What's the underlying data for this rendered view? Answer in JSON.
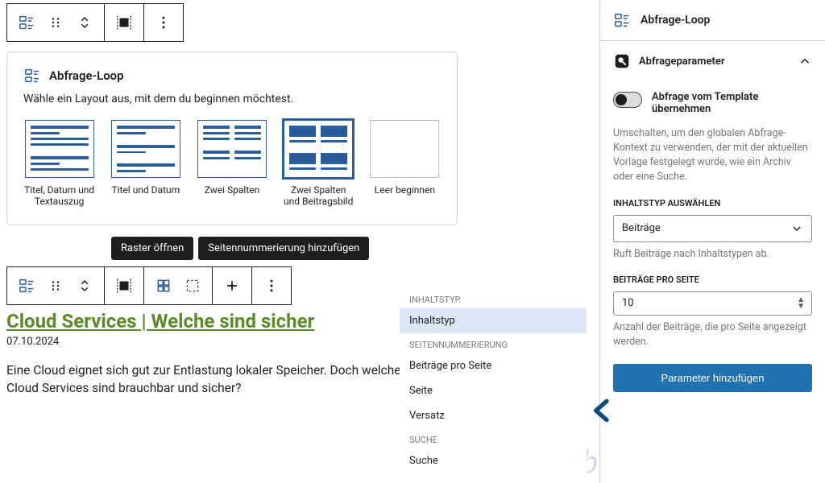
{
  "canvas": {
    "block": {
      "icon": "query-loop",
      "title": "Abfrage-Loop",
      "subtitle": "Wähle ein Layout aus, mit dem du beginnen möchtest.",
      "patterns": [
        {
          "id": "title-date-excerpt",
          "label": "Titel, Datum und Textauszug"
        },
        {
          "id": "title-date",
          "label": "Titel und Datum"
        },
        {
          "id": "two-col",
          "label": "Zwei Spalten"
        },
        {
          "id": "two-col-image",
          "label": "Zwei Spalten und Beitragsbild",
          "selected": true
        },
        {
          "id": "blank",
          "label": "Leer beginnen"
        }
      ]
    },
    "pills": {
      "open_grid": "Raster öffnen",
      "add_pagination": "Seitennummerierung hinzufügen"
    },
    "post": {
      "title": "Cloud Services | Welche sind sicher",
      "date": "07.10.2024",
      "excerpt": "Eine Cloud eignet sich gut zur Entlastung lokaler Speicher. Doch welche Cloud Services sind brauchbar und sicher?"
    },
    "dropdown": {
      "groups": [
        {
          "label": "INHALTSTYP",
          "items": [
            {
              "label": "Inhaltstyp",
              "active": true
            }
          ]
        },
        {
          "label": "SEITENNUMMERIERUNG",
          "items": [
            {
              "label": "Beiträge pro Seite"
            },
            {
              "label": "Seite"
            },
            {
              "label": "Versatz"
            }
          ]
        },
        {
          "label": "SUCHE",
          "items": [
            {
              "label": "Suche"
            }
          ]
        }
      ]
    }
  },
  "sidebar": {
    "block_name": "Abfrage-Loop",
    "panel_title": "Abfrageparameter",
    "inherit": {
      "label": "Abfrage vom Template übernehmen",
      "help": "Umschalten, um den globalen Abfrage-Kontext zu verwenden, der mit der aktuellen Vorlage festgelegt wurde, wie ein Archiv oder eine Suche."
    },
    "post_type": {
      "label": "INHALTSTYP AUSWÄHLEN",
      "value": "Beiträge",
      "help": "Ruft Beiträge nach Inhaltstypen ab."
    },
    "per_page": {
      "label": "BEITRÄGE PRO SEITE",
      "value": "10",
      "help": "Anzahl der Beiträge, die pro Seite angezeigt werden."
    },
    "add_param_button": "Parameter hinzufügen"
  },
  "watermark": "eb"
}
